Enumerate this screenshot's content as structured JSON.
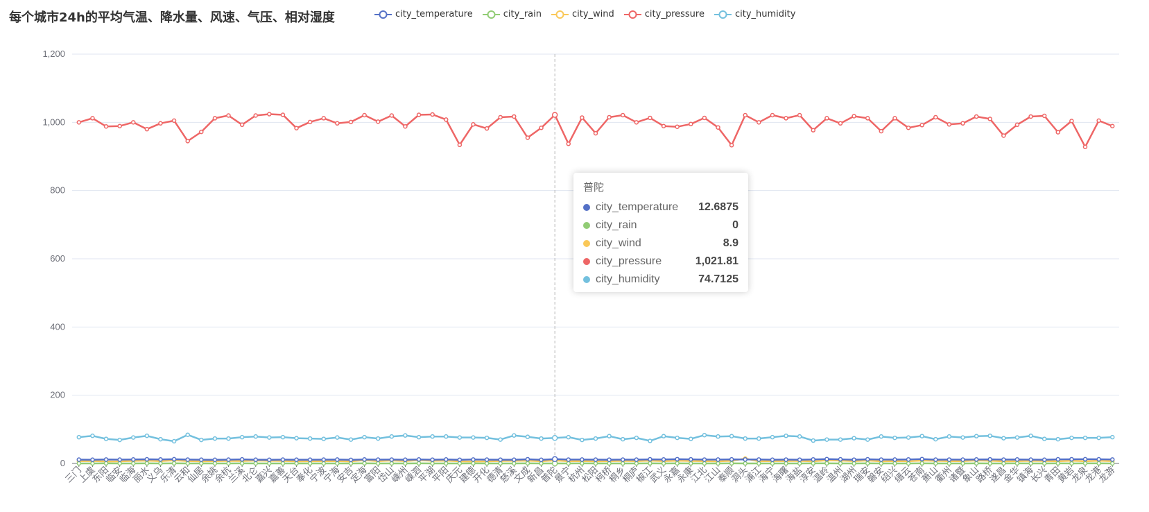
{
  "chart_data": {
    "type": "line",
    "title": "每个城市24h的平均气温、降水量、风速、气压、相对湿度",
    "ylim": [
      0,
      1200
    ],
    "y_ticks": [
      "0",
      "200",
      "400",
      "600",
      "800",
      "1,000",
      "1,200"
    ],
    "grid": true,
    "legend_position": "top",
    "categories": [
      "三门",
      "上虞",
      "东阳",
      "临安",
      "临海",
      "丽水",
      "义乌",
      "乐清",
      "云和",
      "仙居",
      "余姚",
      "余杭",
      "兰溪",
      "北仑",
      "嘉兴",
      "嘉善",
      "天台",
      "奉化",
      "宁波",
      "宁海",
      "安吉",
      "定海",
      "富阳",
      "岱山",
      "嵊州",
      "嵊泗",
      "平湖",
      "平阳",
      "庆元",
      "建德",
      "开化",
      "德清",
      "慈溪",
      "文成",
      "新昌",
      "普陀",
      "景宁",
      "杭州",
      "松阳",
      "柯桥",
      "桐乡",
      "桐庐",
      "椒江",
      "武义",
      "永嘉",
      "永康",
      "江北",
      "江山",
      "泰顺",
      "洞头",
      "浦江",
      "海宁",
      "海曙",
      "海盐",
      "淳安",
      "温岭",
      "温州",
      "湖州",
      "瑞安",
      "磐安",
      "绍兴",
      "缙云",
      "苍南",
      "萧山",
      "衢州",
      "诸暨",
      "象山",
      "路桥",
      "遂昌",
      "金华",
      "镇海",
      "长兴",
      "青田",
      "黄岩",
      "龙泉",
      "龙港",
      "龙游"
    ],
    "series": [
      {
        "name": "city_temperature",
        "color": "#5470c6",
        "values": [
          11.2,
          10.9,
          11.5,
          11.1,
          11.6,
          12.2,
          11.8,
          12.4,
          11.3,
          11.0,
          10.7,
          11.2,
          11.9,
          10.9,
          10.8,
          11.1,
          11.0,
          10.9,
          11.2,
          11.4,
          10.5,
          11.6,
          11.2,
          11.3,
          10.9,
          11.7,
          11.0,
          11.6,
          10.8,
          11.5,
          11.2,
          11.0,
          10.9,
          12.3,
          10.6,
          12.6875,
          11.3,
          11.4,
          11.1,
          11.0,
          11.2,
          11.1,
          12.1,
          11.6,
          12.5,
          12.0,
          11.3,
          11.4,
          11.9,
          11.6,
          11.5,
          10.9,
          11.3,
          11.0,
          11.8,
          12.6,
          12.1,
          11.0,
          12.2,
          11.3,
          11.4,
          11.8,
          12.6,
          11.2,
          11.3,
          11.2,
          11.6,
          12.0,
          11.3,
          11.7,
          11.2,
          10.9,
          12.1,
          12.3,
          12.4,
          12.2,
          11.5
        ]
      },
      {
        "name": "city_rain",
        "color": "#91cc75",
        "values": [
          0.1,
          0,
          0.2,
          0,
          0.1,
          0.3,
          0,
          0.2,
          0.1,
          0,
          0,
          0.1,
          0.2,
          0,
          0,
          0,
          0.1,
          0,
          0,
          0.1,
          0,
          0.2,
          0,
          0.1,
          0,
          0.2,
          0,
          0.1,
          0,
          0.2,
          0.1,
          0,
          0,
          0.3,
          0,
          0,
          0.1,
          0.2,
          0,
          0.1,
          0,
          0.1,
          0.2,
          0,
          0.3,
          0.1,
          0,
          0.1,
          0.2,
          0,
          0.1,
          0,
          0.1,
          0,
          0.2,
          0.3,
          0.1,
          0,
          0.2,
          0.1,
          0,
          0.1,
          0.2,
          0,
          0.1,
          0,
          0.2,
          0.1,
          0,
          0.2,
          0,
          0.1,
          0.2,
          0.1,
          0.3,
          0.2,
          0.1
        ]
      },
      {
        "name": "city_wind",
        "color": "#fac858",
        "values": [
          6.5,
          7.2,
          5.8,
          6.0,
          7.4,
          8.1,
          6.6,
          9.2,
          7.0,
          6.1,
          6.8,
          7.3,
          6.9,
          8.4,
          7.5,
          7.1,
          6.2,
          6.4,
          6.6,
          6.9,
          5.9,
          9.5,
          6.7,
          8.8,
          7.0,
          9.6,
          7.8,
          8.2,
          6.0,
          5.8,
          6.1,
          7.1,
          7.6,
          8.0,
          6.4,
          8.9,
          6.3,
          6.9,
          6.2,
          6.8,
          7.4,
          6.5,
          8.1,
          6.7,
          8.0,
          7.2,
          6.6,
          6.0,
          7.8,
          14.2,
          6.3,
          7.0,
          6.9,
          7.4,
          6.1,
          9.1,
          8.4,
          6.8,
          8.7,
          6.2,
          6.9,
          6.4,
          8.3,
          7.6,
          6.5,
          6.7,
          8.5,
          7.9,
          6.1,
          6.6,
          7.8,
          7.2,
          6.3,
          8.0,
          6.4,
          7.9,
          6.5
        ]
      },
      {
        "name": "city_pressure",
        "color": "#ee6666",
        "values": [
          1000,
          1012,
          988,
          989,
          1000,
          980,
          997,
          1005,
          945,
          972,
          1012,
          1020,
          993,
          1020,
          1024,
          1022,
          983,
          1001,
          1012,
          997,
          1001,
          1021,
          1002,
          1020,
          988,
          1022,
          1023,
          1008,
          934,
          994,
          982,
          1015,
          1017,
          955,
          984,
          1021.81,
          937,
          1014,
          968,
          1015,
          1021,
          1000,
          1013,
          989,
          987,
          995,
          1013,
          985,
          933,
          1021,
          1000,
          1021,
          1012,
          1021,
          977,
          1012,
          997,
          1018,
          1012,
          974,
          1012,
          984,
          992,
          1015,
          994,
          997,
          1017,
          1010,
          961,
          993,
          1017,
          1019,
          971,
          1004,
          928,
          1005,
          989
        ]
      },
      {
        "name": "city_humidity",
        "color": "#73c0de",
        "values": [
          77,
          81,
          72,
          69,
          76,
          81,
          71,
          65,
          84,
          69,
          73,
          73,
          77,
          79,
          76,
          77,
          74,
          73,
          72,
          76,
          70,
          77,
          73,
          79,
          82,
          77,
          79,
          79,
          76,
          76,
          75,
          70,
          82,
          78,
          73,
          74.7125,
          77,
          69,
          73,
          80,
          71,
          75,
          66,
          80,
          75,
          72,
          83,
          79,
          80,
          73,
          73,
          77,
          81,
          79,
          67,
          70,
          70,
          74,
          70,
          79,
          75,
          76,
          80,
          71,
          79,
          76,
          80,
          81,
          74,
          76,
          81,
          72,
          71,
          75,
          75,
          75,
          77
        ]
      }
    ]
  },
  "tooltip": {
    "title": "普陀",
    "rows": [
      {
        "name": "city_temperature",
        "value": "12.6875",
        "color": "#5470c6"
      },
      {
        "name": "city_rain",
        "value": "0",
        "color": "#91cc75"
      },
      {
        "name": "city_wind",
        "value": "8.9",
        "color": "#fac858"
      },
      {
        "name": "city_pressure",
        "value": "1,021.81",
        "color": "#ee6666"
      },
      {
        "name": "city_humidity",
        "value": "74.7125",
        "color": "#73c0de"
      }
    ]
  }
}
